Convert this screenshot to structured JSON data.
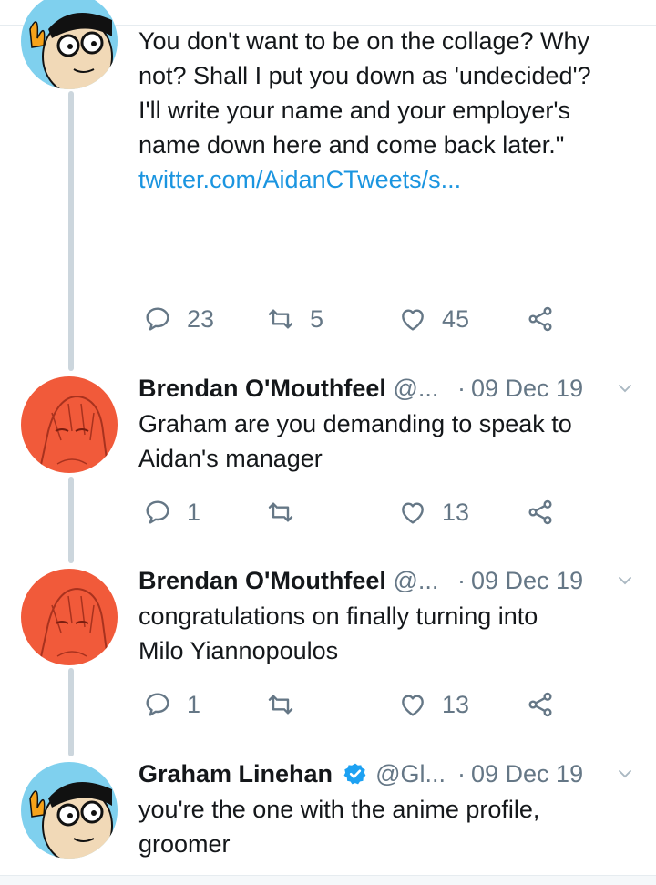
{
  "colors": {
    "link": "#1b95e0",
    "secondary": "#657786",
    "verified": "#1da1f2",
    "thread_line": "#ccd6dd"
  },
  "tweet1": {
    "text_lines": [
      "You don't want to be on the collage? Why",
      "not? Shall I put you down as 'undecided'?",
      "I'll write your name and your employer's",
      "name down here and come back later.\""
    ],
    "link": "twitter.com/AidanCTweets/s...",
    "reply_count": "23",
    "retweet_count": "5",
    "like_count": "45"
  },
  "tweet2": {
    "name": "Brendan O'Mouthfeel",
    "handle": "@...",
    "dot": "·",
    "date": "09 Dec 19",
    "text_lines": [
      "Graham are you demanding to speak to",
      "Aidan's manager"
    ],
    "reply_count": "1",
    "like_count": "13"
  },
  "tweet3": {
    "name": "Brendan O'Mouthfeel",
    "handle": "@...",
    "dot": "·",
    "date": "09 Dec 19",
    "text_lines": [
      "congratulations on finally turning into",
      "Milo Yiannopoulos"
    ],
    "reply_count": "1",
    "like_count": "13"
  },
  "tweet4": {
    "name": "Graham Linehan",
    "handle": "@Gl...",
    "dot": "·",
    "date": "09 Dec 19",
    "verified": true,
    "text_lines": [
      "you're the one with the anime profile,",
      "groomer"
    ]
  },
  "icons": [
    "reply-icon",
    "retweet-icon",
    "like-icon",
    "share-icon",
    "chevron-down-icon",
    "verified-icon"
  ]
}
